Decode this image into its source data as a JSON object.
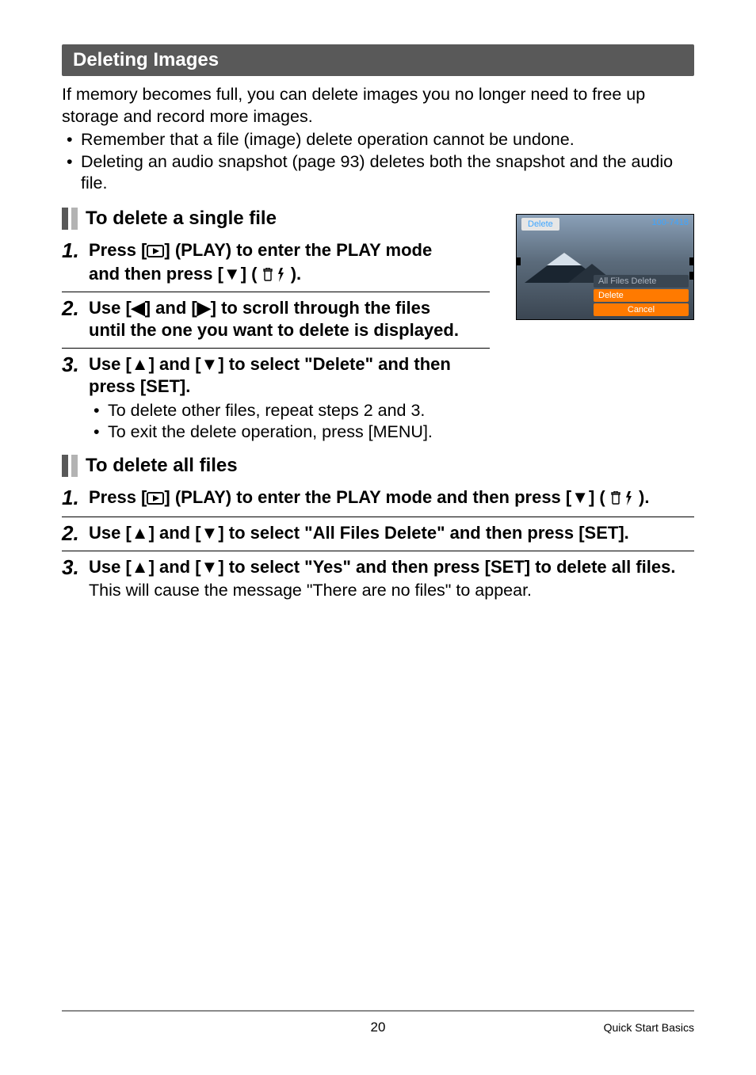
{
  "section": {
    "title": "Deleting Images"
  },
  "intro": {
    "para": "If memory becomes full, you can delete images you no longer need to free up storage and record more images.",
    "bullets": [
      "Remember that a file (image) delete operation cannot be undone.",
      "Deleting an audio snapshot (page 93) deletes both the snapshot and the audio file."
    ]
  },
  "sub1": {
    "title": "To delete a single file",
    "steps": {
      "s1": {
        "num": "1.",
        "line1_pre": "Press [",
        "line1_post": "] (PLAY) to enter the PLAY mode",
        "line2_pre": "and then press [▼] ( ",
        "line2_post": " )."
      },
      "s2": {
        "num": "2.",
        "line1": "Use [◀] and [▶] to scroll through the files",
        "line2": "until the one you want to delete is displayed."
      },
      "s3": {
        "num": "3.",
        "line1": "Use [▲] and [▼] to select \"Delete\" and then",
        "line2": "press [SET].",
        "sub": [
          "To delete other files, repeat steps 2 and 3.",
          "To exit the delete operation, press [MENU]."
        ]
      }
    }
  },
  "sub2": {
    "title": "To delete all files",
    "steps": {
      "s1": {
        "num": "1.",
        "line_pre": "Press [",
        "line_mid": "] (PLAY) to enter the PLAY mode and then press [▼] ( ",
        "line_post": " )."
      },
      "s2": {
        "num": "2.",
        "line": "Use [▲] and [▼] to select \"All Files Delete\" and then press [SET]."
      },
      "s3": {
        "num": "3.",
        "line": "Use [▲] and [▼] to select \"Yes\" and then press [SET] to delete all files.",
        "sub": "This will cause the message \"There are no files\" to appear."
      }
    }
  },
  "screenshot": {
    "topbar": "Delete",
    "id": "100-7418",
    "menu": {
      "all": "All Files Delete",
      "del": "Delete",
      "cancel": "Cancel"
    }
  },
  "footer": {
    "page": "20",
    "crumb": "Quick Start Basics"
  }
}
